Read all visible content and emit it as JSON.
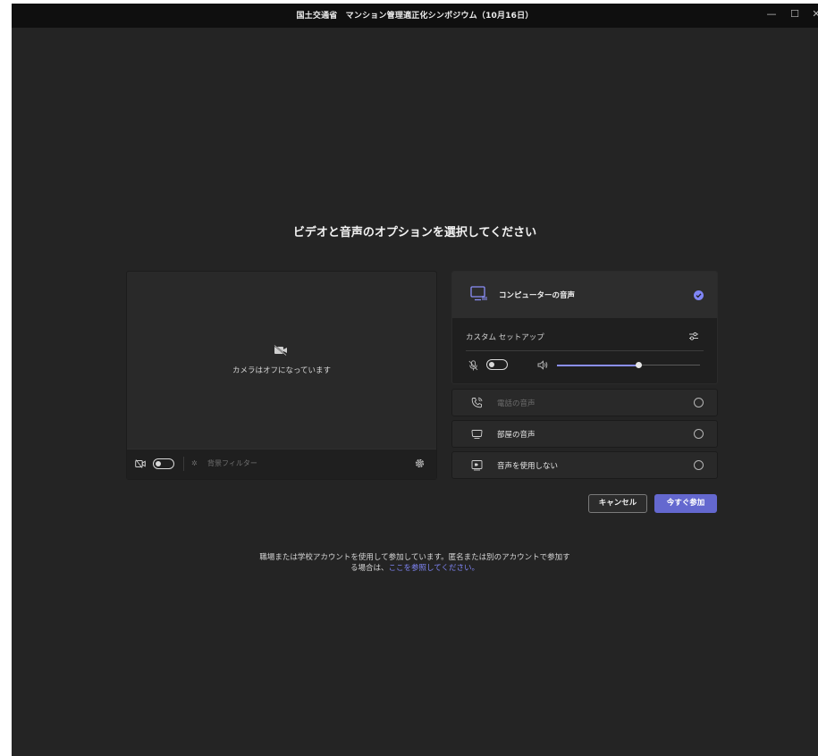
{
  "window": {
    "title": "国土交通省　マンション管理適正化シンポジウム（10月16日）",
    "controls": {
      "minimize": "—",
      "maximize": "☐",
      "close": "✕"
    }
  },
  "main": {
    "heading": "ビデオと音声のオプションを選択してください"
  },
  "video": {
    "camera_off_text": "カメラはオフになっています",
    "camera_toggle_on": false,
    "background_filter_label": "背景フィルター"
  },
  "audio": {
    "computer_audio": {
      "label": "コンピューターの音声",
      "selected": true,
      "custom_setup_label": "カスタム セットアップ",
      "mic_on": false,
      "speaker_volume": 0.57
    },
    "options": [
      {
        "label": "電話の音声",
        "icon": "phone-icon",
        "disabled": true
      },
      {
        "label": "部屋の音声",
        "icon": "room-audio-icon",
        "disabled": false
      },
      {
        "label": "音声を使用しない",
        "icon": "no-audio-icon",
        "disabled": false
      }
    ]
  },
  "actions": {
    "cancel_label": "キャンセル",
    "join_label": "今すぐ参加"
  },
  "footer": {
    "text_line1": "職場または学校アカウントを使用して参加しています。匿名または別のアカウントで参加す",
    "text_line2_prefix": "る場合は、",
    "link_text": "ここを参照してください。"
  },
  "colors": {
    "accent": "#7f85f5",
    "join_button": "#6468cf",
    "background": "#242424",
    "titlebar": "#0f0f0f"
  }
}
